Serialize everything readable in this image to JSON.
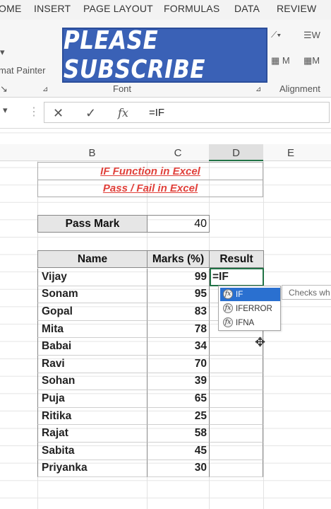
{
  "ribbon": {
    "tabs": [
      "OME",
      "INSERT",
      "PAGE LAYOUT",
      "FORMULAS",
      "DATA",
      "REVIEW"
    ],
    "format_painter": "mat Painter",
    "group_labels": {
      "font": "Font",
      "alignment": "Alignment"
    }
  },
  "banner": {
    "text": "PLEASE SUBSCRIBE"
  },
  "formula_bar": {
    "formula": "=IF",
    "cancel": "✕",
    "enter": "✓",
    "fx": "fx"
  },
  "columns": [
    "B",
    "C",
    "D",
    "E"
  ],
  "titles": {
    "line1": "IF Function in Excel",
    "line2": "Pass / Fail in Excel"
  },
  "pass_mark": {
    "label": "Pass Mark",
    "value": "40"
  },
  "table": {
    "headers": [
      "Name",
      "Marks (%)",
      "Result"
    ],
    "rows": [
      {
        "name": "Vijay",
        "marks": "99"
      },
      {
        "name": "Sonam",
        "marks": "95"
      },
      {
        "name": "Gopal",
        "marks": "83"
      },
      {
        "name": "Mita",
        "marks": "78"
      },
      {
        "name": "Babai",
        "marks": "34"
      },
      {
        "name": "Ravi",
        "marks": "70"
      },
      {
        "name": "Sohan",
        "marks": "39"
      },
      {
        "name": "Puja",
        "marks": "65"
      },
      {
        "name": "Ritika",
        "marks": "25"
      },
      {
        "name": "Rajat",
        "marks": "58"
      },
      {
        "name": "Sabita",
        "marks": "45"
      },
      {
        "name": "Priyanka",
        "marks": "30"
      }
    ]
  },
  "active_cell": {
    "text": "=IF"
  },
  "autocomplete": {
    "items": [
      "IF",
      "IFERROR",
      "IFNA"
    ],
    "selected": "IF",
    "tooltip": "Checks wh"
  }
}
